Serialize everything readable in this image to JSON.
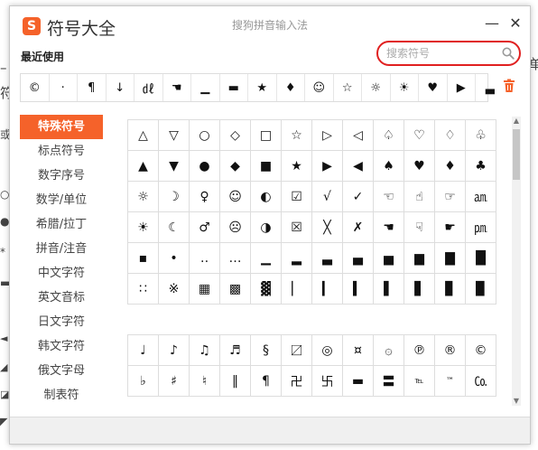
{
  "background_fragments": [
    "–",
    "符",
    "单",
    "或",
    "○",
    "●",
    "*",
    "▬",
    "◄",
    "◢",
    "◪",
    "◤"
  ],
  "window": {
    "app_title": "符号大全",
    "title": "搜狗拼音输入法",
    "accent_color": "#f5622a",
    "logo_letter": "S",
    "minimize_label": "—",
    "close_label": "✕"
  },
  "recent": {
    "label": "最近使用",
    "symbols": [
      "©",
      "·",
      "¶",
      "↓",
      "㎗",
      "☚",
      "▁",
      "▬",
      "★",
      "♦",
      "☺",
      "☆",
      "☼",
      "☀",
      "♥",
      "▶",
      "▃"
    ]
  },
  "search": {
    "placeholder": "搜索符号",
    "value": ""
  },
  "sidebar": {
    "items": [
      {
        "label": "特殊符号",
        "active": true
      },
      {
        "label": "标点符号",
        "active": false
      },
      {
        "label": "数字序号",
        "active": false
      },
      {
        "label": "数学/单位",
        "active": false
      },
      {
        "label": "希腊/拉丁",
        "active": false
      },
      {
        "label": "拼音/注音",
        "active": false
      },
      {
        "label": "中文字符",
        "active": false
      },
      {
        "label": "英文音标",
        "active": false
      },
      {
        "label": "日文字符",
        "active": false
      },
      {
        "label": "韩文字符",
        "active": false
      },
      {
        "label": "俄文字母",
        "active": false
      },
      {
        "label": "制表符",
        "active": false
      }
    ]
  },
  "grid1": {
    "rows": [
      [
        "△",
        "▽",
        "○",
        "◇",
        "□",
        "☆",
        "▷",
        "◁",
        "♤",
        "♡",
        "♢",
        "♧"
      ],
      [
        "▲",
        "▼",
        "●",
        "◆",
        "■",
        "★",
        "▶",
        "◀",
        "♠",
        "♥",
        "♦",
        "♣"
      ],
      [
        "☼",
        "☽",
        "♀",
        "☺",
        "◐",
        "☑",
        "√",
        "✓",
        "☜",
        "☝",
        "☞",
        "㏂"
      ],
      [
        "☀",
        "☾",
        "♂",
        "☹",
        "◑",
        "☒",
        "╳",
        "✗",
        "☚",
        "☟",
        "☛",
        "㏘"
      ],
      [
        "▪",
        "•",
        "‥",
        "…",
        "▁",
        "▂",
        "▃",
        "▄",
        "▅",
        "▆",
        "▇",
        "█"
      ],
      [
        "∷",
        "※",
        "▦",
        "▩",
        "▓",
        "▏",
        "▎",
        "▍",
        "▌",
        "▋",
        "▊",
        "▉"
      ]
    ]
  },
  "grid2": {
    "rows": [
      [
        "♩",
        "♪",
        "♫",
        "♬",
        "§",
        "〼",
        "◎",
        "¤",
        "۞",
        "℗",
        "®",
        "©"
      ],
      [
        "♭",
        "♯",
        "♮",
        "‖",
        "¶",
        "卍",
        "卐",
        "▬",
        "〓",
        "℡",
        "™",
        "㏇"
      ]
    ]
  },
  "scrollbar": {
    "up_arrow": "▲",
    "down_arrow": "▼"
  }
}
